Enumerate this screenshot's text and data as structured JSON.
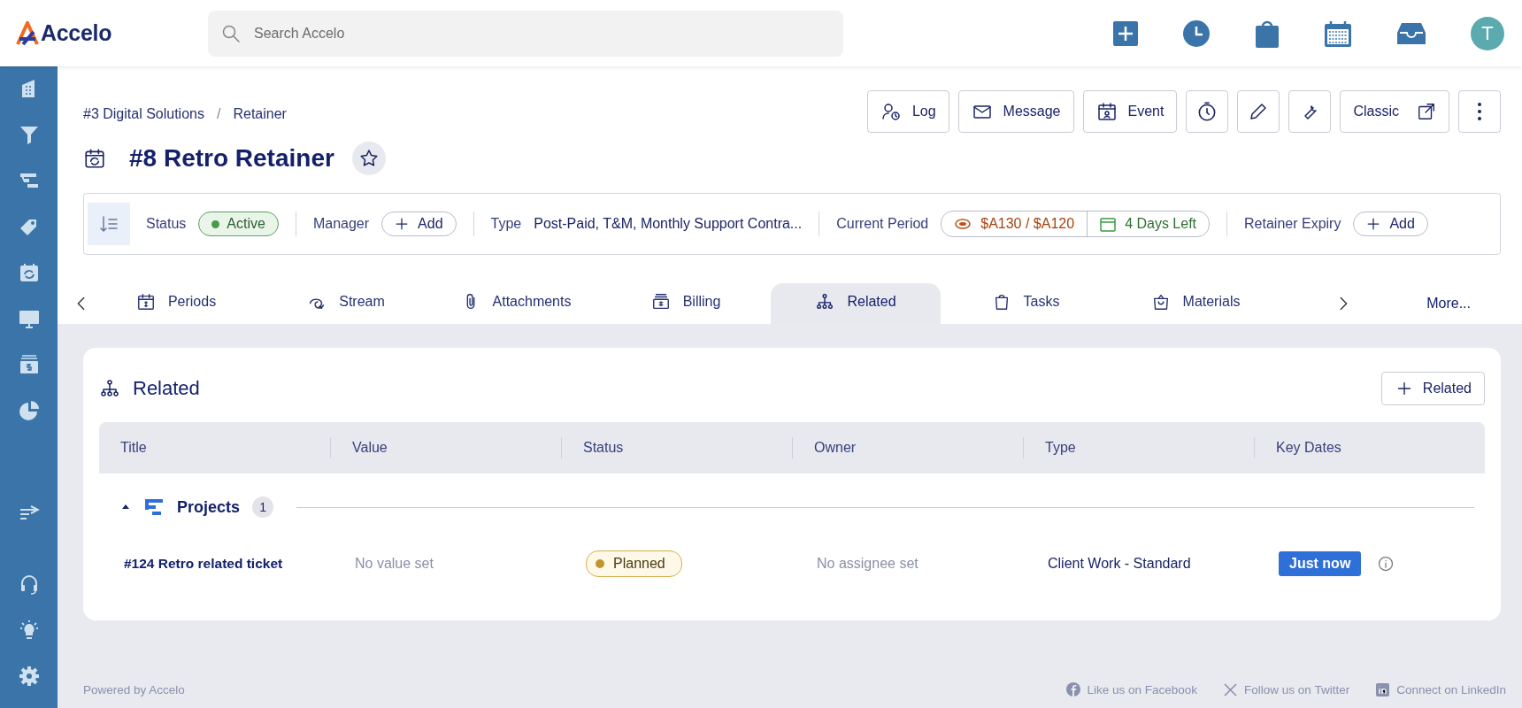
{
  "app": {
    "logo": "Accelo"
  },
  "search": {
    "placeholder": "Search Accelo"
  },
  "user": {
    "initial": "T"
  },
  "breadcrumb": [
    "#3 Digital Solutions",
    "Retainer"
  ],
  "breadcrumb_separator": "/",
  "actions": [
    "Log",
    "Message",
    "Event"
  ],
  "classic": "Classic",
  "title": "#8 Retro Retainer",
  "starred": false,
  "info": {
    "status_label": "Status",
    "status": "Active",
    "manager_label": "Manager",
    "manager_button": "Add",
    "type_label": "Type",
    "type": "Post-Paid, T&M, Monthly Support Contra...",
    "period_label": "Current Period",
    "amount": "$A130 / $A120",
    "days_left": "4 Days Left",
    "expiry_label": "Retainer Expiry",
    "expiry_button": "Add"
  },
  "tabs": [
    {
      "label": "Periods",
      "selected": false
    },
    {
      "label": "Stream",
      "selected": false
    },
    {
      "label": "Attachments",
      "selected": false
    },
    {
      "label": "Billing",
      "selected": false
    },
    {
      "label": "Related",
      "selected": true
    },
    {
      "label": "Tasks",
      "selected": false
    },
    {
      "label": "Materials",
      "selected": false
    }
  ],
  "more_tab": "More...",
  "related": {
    "title": "Related",
    "add_button": "Related",
    "columns": [
      "Title",
      "Value",
      "Status",
      "Owner",
      "Type",
      "Key Dates"
    ],
    "groups": [
      {
        "name": "Projects",
        "count": "1",
        "expanded": true,
        "rows": [
          {
            "title": "#124 Retro related ticket",
            "value": "No value set",
            "status": "Planned",
            "owner": "No assignee set",
            "type": "Client Work - Standard",
            "key_date": "Just now"
          }
        ]
      }
    ]
  },
  "footer": {
    "powered": "Powered by Accelo",
    "links": [
      "Like us on Facebook",
      "Follow us on Twitter",
      "Connect on LinkedIn"
    ]
  }
}
